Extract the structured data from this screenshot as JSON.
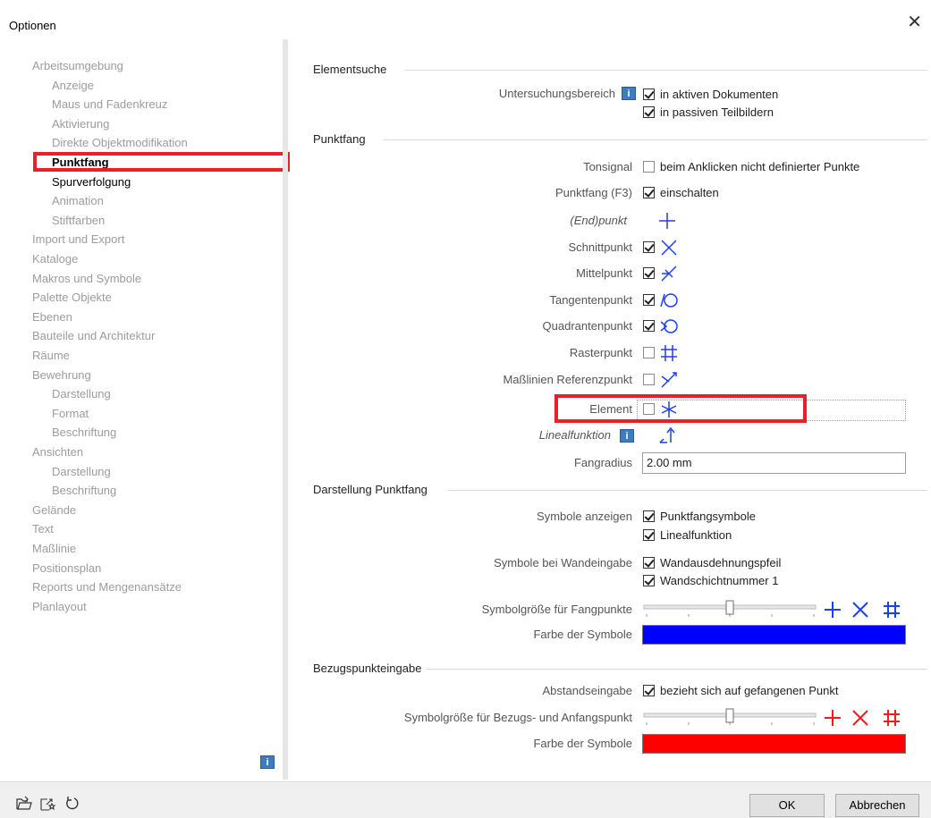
{
  "window": {
    "title": "Optionen"
  },
  "tree": [
    {
      "label": "Arbeitsumgebung",
      "level": 1,
      "state": "dim"
    },
    {
      "label": "Anzeige",
      "level": 2,
      "state": "dim"
    },
    {
      "label": "Maus und Fadenkreuz",
      "level": 2,
      "state": "dim"
    },
    {
      "label": "Aktivierung",
      "level": 2,
      "state": "dim"
    },
    {
      "label": "Direkte Objektmodifikation",
      "level": 2,
      "state": "dim"
    },
    {
      "label": "Punktfang",
      "level": 2,
      "state": "selected"
    },
    {
      "label": "Spurverfolgung",
      "level": 2,
      "state": "active"
    },
    {
      "label": "Animation",
      "level": 2,
      "state": "dim"
    },
    {
      "label": "Stiftfarben",
      "level": 2,
      "state": "dim"
    },
    {
      "label": "Import und Export",
      "level": 1,
      "state": "dim"
    },
    {
      "label": "Kataloge",
      "level": 1,
      "state": "dim"
    },
    {
      "label": "Makros und Symbole",
      "level": 1,
      "state": "dim"
    },
    {
      "label": "Palette Objekte",
      "level": 1,
      "state": "dim"
    },
    {
      "label": "Ebenen",
      "level": 1,
      "state": "dim"
    },
    {
      "label": "Bauteile und Architektur",
      "level": 1,
      "state": "dim"
    },
    {
      "label": "Räume",
      "level": 1,
      "state": "dim"
    },
    {
      "label": "Bewehrung",
      "level": 1,
      "state": "dim"
    },
    {
      "label": "Darstellung",
      "level": 2,
      "state": "dim"
    },
    {
      "label": "Format",
      "level": 2,
      "state": "dim"
    },
    {
      "label": "Beschriftung",
      "level": 2,
      "state": "dim"
    },
    {
      "label": "Ansichten",
      "level": 1,
      "state": "dim"
    },
    {
      "label": "Darstellung",
      "level": 2,
      "state": "dim"
    },
    {
      "label": "Beschriftung",
      "level": 2,
      "state": "dim"
    },
    {
      "label": "Gelände",
      "level": 1,
      "state": "dim"
    },
    {
      "label": "Text",
      "level": 1,
      "state": "dim"
    },
    {
      "label": "Maßlinie",
      "level": 1,
      "state": "dim"
    },
    {
      "label": "Positionsplan",
      "level": 1,
      "state": "dim"
    },
    {
      "label": "Reports und Mengenansätze",
      "level": 1,
      "state": "dim"
    },
    {
      "label": "Planlayout",
      "level": 1,
      "state": "dim"
    }
  ],
  "sections": {
    "elementsuche": "Elementsuche",
    "punktfang": "Punktfang",
    "darstellung": "Darstellung Punktfang",
    "bezugspunkt": "Bezugspunkteingabe"
  },
  "elementsuche": {
    "label": "Untersuchungsbereich",
    "opt1": "in aktiven Dokumenten",
    "opt2": "in passiven Teilbildern"
  },
  "punktfang": {
    "tonsignal_label": "Tonsignal",
    "tonsignal_text": "beim Anklicken nicht definierter Punkte",
    "f3_label": "Punktfang (F3)",
    "f3_text": "einschalten",
    "endpunkt": "(End)punkt",
    "schnittpunkt": "Schnittpunkt",
    "mittelpunkt": "Mittelpunkt",
    "tangentenpunkt": "Tangentenpunkt",
    "quadrantenpunkt": "Quadrantenpunkt",
    "rasterpunkt": "Rasterpunkt",
    "masslinien": "Maßlinien Referenzpunkt",
    "element": "Element",
    "linealfunktion": "Linealfunktion",
    "fangradius_label": "Fangradius",
    "fangradius_value": "2.00 mm"
  },
  "darstellung": {
    "symbole_label": "Symbole anzeigen",
    "symbole_opt1": "Punktfangsymbole",
    "symbole_opt2": "Linealfunktion",
    "wand_label": "Symbole bei Wandeingabe",
    "wand_opt1": "Wandausdehnungspfeil",
    "wand_opt2": "Wandschichtnummer 1",
    "groesse_label": "Symbolgröße für Fangpunkte",
    "farbe_label": "Farbe der Symbole",
    "farbe_value": "#0000ff",
    "slider_level": 0.5
  },
  "bezug": {
    "abstand_label": "Abstandseingabe",
    "abstand_text": "bezieht sich auf gefangenen Punkt",
    "groesse_label": "Symbolgröße für Bezugs- und Anfangspunkt",
    "farbe_label": "Farbe der Symbole",
    "farbe_value": "#ff0000",
    "slider_level": 0.5
  },
  "buttons": {
    "ok": "OK",
    "cancel": "Abbrechen"
  },
  "info_glyph": "i",
  "colors": {
    "highlight": "#e8202a",
    "info": "#3f7bbf"
  }
}
